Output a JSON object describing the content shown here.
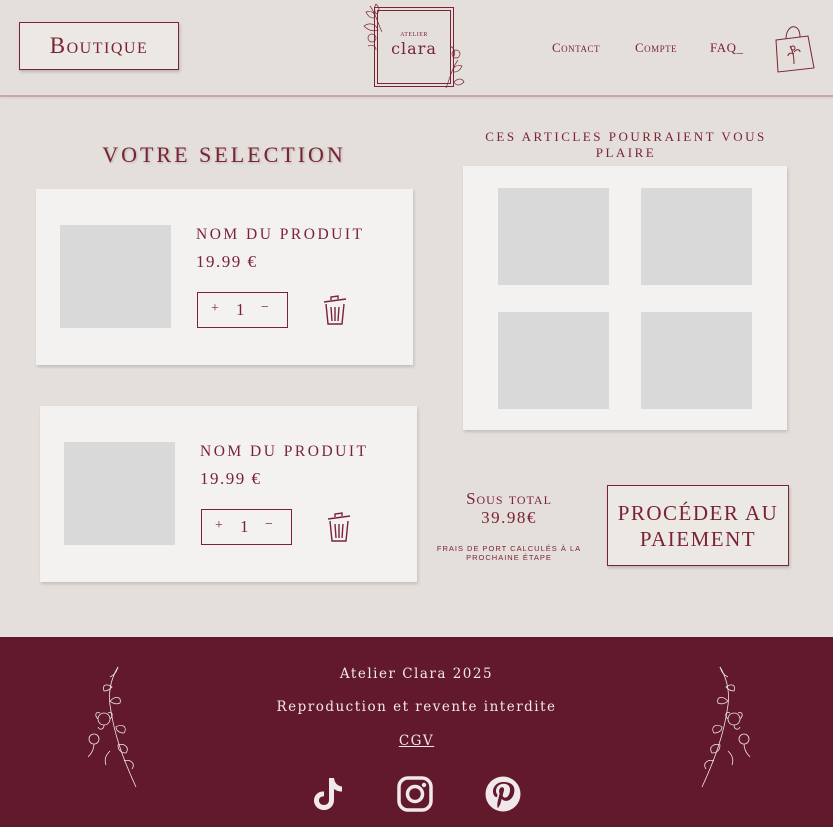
{
  "header": {
    "boutique_label": "Boutique",
    "logo_top": "ATELIER",
    "logo_name": "clara",
    "nav": [
      "Contact",
      "Compte",
      "FAQ_"
    ]
  },
  "selection": {
    "title": "VOTRE SELECTION",
    "items": [
      {
        "name": "NOM DU PRODUIT",
        "price": "19.99 €",
        "plus": "+",
        "qty": "1",
        "minus": "−"
      },
      {
        "name": "NOM DU PRODUIT",
        "price": "19.99 €",
        "plus": "+",
        "qty": "1",
        "minus": "−"
      }
    ]
  },
  "suggestions": {
    "title": "CES ARTICLES POURRAIENT VOUS PLAIRE"
  },
  "summary": {
    "subtotal_label": "Sous total",
    "subtotal_value": "39.98€",
    "shipping_note": "FRAIS DE PORT CALCULÉS À LA PROCHAINE ÉTAPE",
    "checkout_label": "PROCÉDER AU PAIEMENT"
  },
  "footer": {
    "copyright": "Atelier Clara 2025",
    "notice": "Reproduction et revente interdite",
    "cgv": "CGV",
    "social_icons": [
      "tiktok-icon",
      "instagram-icon",
      "pinterest-icon"
    ]
  },
  "colors": {
    "background": "#e4dfdb",
    "accent": "#7a2338",
    "footer_bg": "#62192c",
    "card_bg": "#f4f2f1",
    "placeholder": "#d9d9d9"
  }
}
